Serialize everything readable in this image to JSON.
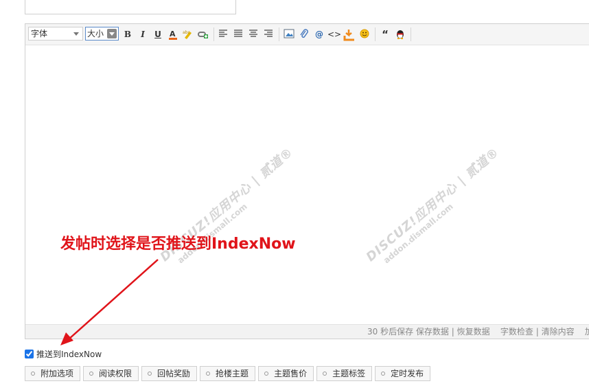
{
  "subject": {
    "value": ""
  },
  "toolbar": {
    "font_label": "字体",
    "size_label": "大小",
    "bold": "B",
    "italic": "I",
    "underline": "U",
    "quote": "“",
    "code": "<>"
  },
  "status": {
    "autosave": "30 秒后保存",
    "save": "保存数据",
    "restore": "恢复数据",
    "wordcheck": "字数检查",
    "clear": "清除内容",
    "extra": "加"
  },
  "annotation": "发帖时选择是否推送到IndexNow",
  "push": {
    "label": "推送到IndexNow",
    "checked": true
  },
  "options": [
    {
      "label": "附加选项"
    },
    {
      "label": "阅读权限"
    },
    {
      "label": "回帖奖励"
    },
    {
      "label": "抢楼主题"
    },
    {
      "label": "主题售价"
    },
    {
      "label": "主题标签"
    },
    {
      "label": "定时发布"
    }
  ],
  "watermark": {
    "brand": "DISCUZ!应用中心",
    "site": "addon.dismall.com",
    "mark": "贰道®"
  },
  "colors": {
    "annotation": "#e0141a",
    "checkbox": "#1a73e8"
  }
}
